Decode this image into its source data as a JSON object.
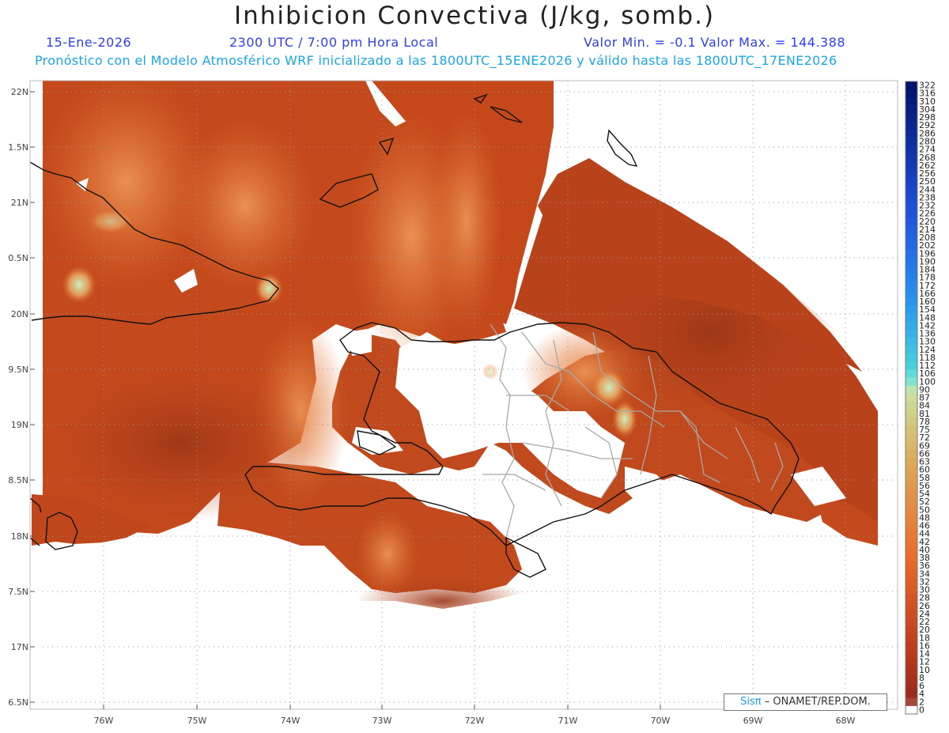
{
  "title": "Inhibicion Convectiva (J/kg, somb.)",
  "header": {
    "date": "15-Ene-2026",
    "time": "2300 UTC / 7:00 pm Hora Local",
    "range": "Valor Min. = -0.1  Valor Max. = 144.388"
  },
  "subtitle": "Pronóstico con el Modelo Atmosférico WRF inicializado a las 1800UTC_15ENE2026 y válido hasta las  1800UTC_17ENE2026",
  "axes": {
    "lat_labels": [
      "22N",
      "1.5N",
      "21N",
      "0.5N",
      "20N",
      "9.5N",
      "19N",
      "8.5N",
      "18N",
      "7.5N",
      "17N",
      "6.5N"
    ],
    "lon_labels": [
      "76W",
      "75W",
      "74W",
      "73W",
      "72W",
      "71W",
      "70W",
      "69W",
      "68W"
    ]
  },
  "colorbar": {
    "labels": [
      "322",
      "316",
      "310",
      "304",
      "298",
      "292",
      "286",
      "280",
      "274",
      "268",
      "262",
      "256",
      "250",
      "244",
      "238",
      "232",
      "226",
      "220",
      "214",
      "208",
      "202",
      "196",
      "190",
      "184",
      "178",
      "172",
      "166",
      "160",
      "154",
      "148",
      "142",
      "136",
      "130",
      "124",
      "118",
      "112",
      "106",
      "100",
      "90",
      "87",
      "84",
      "81",
      "78",
      "75",
      "72",
      "69",
      "66",
      "63",
      "60",
      "58",
      "56",
      "54",
      "52",
      "50",
      "48",
      "46",
      "44",
      "42",
      "40",
      "38",
      "36",
      "34",
      "32",
      "30",
      "28",
      "26",
      "24",
      "22",
      "20",
      "18",
      "16",
      "14",
      "12",
      "10",
      "8",
      "6",
      "4",
      "2",
      "0"
    ]
  },
  "credit": {
    "brand": "Sisπ",
    "text": "– ONAMET/REP.DOM."
  },
  "colors": {
    "field_base": "#c4491c",
    "field_dark": "#9b3617",
    "field_light": "#dc6b2c",
    "field_highlight": "#b9e7b5",
    "coast": "#111111",
    "provinces": "#a8a8a8",
    "header_blue": "#2f3ff2",
    "subtitle_blue": "#1aa7ea"
  }
}
